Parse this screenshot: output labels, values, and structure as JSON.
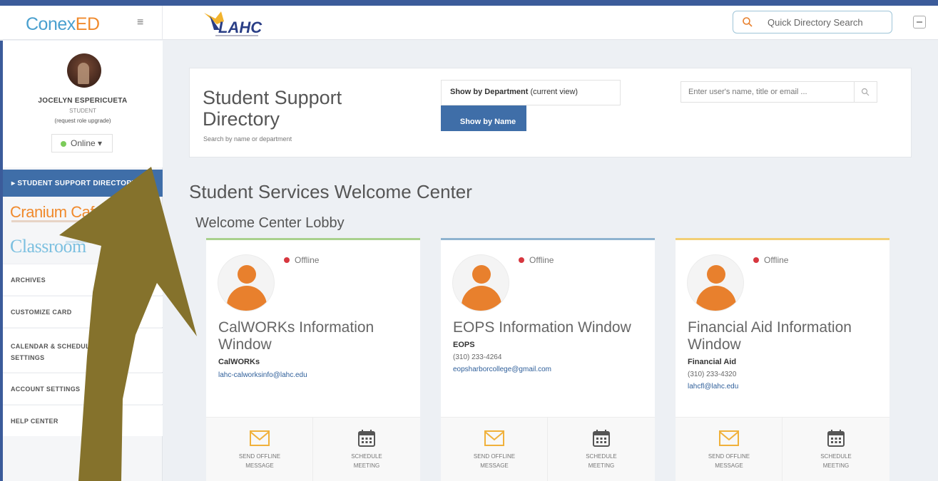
{
  "colors": {
    "accent": "#3f6ea8",
    "brand_blue": "#4aa0cf",
    "brand_orange": "#f08a2c",
    "arrow": "#85722c",
    "offline": "#d7373f",
    "online": "#7ccb5a"
  },
  "header": {
    "brand_part1": "Conex",
    "brand_part2": "ED",
    "menu_icon": "hamburger-icon",
    "logo_text": "LAHC",
    "quick_search_placeholder": "Quick Directory Search"
  },
  "profile": {
    "name": "JOCELYN ESPERICUETA",
    "role": "STUDENT",
    "upgrade": "(request role upgrade)",
    "status": "Online ▾"
  },
  "sidebar": {
    "active_item": "▸ STUDENT SUPPORT DIRECTORY",
    "cranium": "Cranium Cafe",
    "classroom": "Classroom",
    "items": [
      {
        "label": "ARCHIVES"
      },
      {
        "label": "CUSTOMIZE CARD"
      },
      {
        "label_line1": "CALENDAR & SCHEDULE",
        "label_line2": "SETTINGS"
      },
      {
        "label": "ACCOUNT SETTINGS"
      },
      {
        "label": "HELP CENTER"
      }
    ]
  },
  "directory": {
    "title": "Student Support Directory",
    "subtitle": "Search by name or department",
    "dept_button_bold": "Show by Department",
    "dept_button_rest": " (current view)",
    "name_button": "Show by Name",
    "search_placeholder": "Enter user's name, title or email ..."
  },
  "main": {
    "section_title": "Student Services Welcome Center",
    "lobby_title": "Welcome Center Lobby"
  },
  "cards": [
    {
      "status": "Offline",
      "name": "CalWORKs Information Window",
      "dept": "CalWORKs",
      "phone": "",
      "email": "lahc-calworksinfo@lahc.edu",
      "action1_line1": "SEND OFFLINE",
      "action1_line2": "MESSAGE",
      "action2_line1": "SCHEDULE",
      "action2_line2": "MEETING"
    },
    {
      "status": "Offline",
      "name": "EOPS Information Window",
      "dept": "EOPS",
      "phone": "(310) 233-4264",
      "email": "eopsharborcollege@gmail.com",
      "action1_line1": "SEND OFFLINE",
      "action1_line2": "MESSAGE",
      "action2_line1": "SCHEDULE",
      "action2_line2": "MEETING"
    },
    {
      "status": "Offline",
      "name": "Financial Aid Information Window",
      "dept": "Financial Aid",
      "phone": "(310) 233-4320",
      "email": "lahcfl@lahc.edu",
      "action1_line1": "SEND OFFLINE",
      "action1_line2": "MESSAGE",
      "action2_line1": "SCHEDULE",
      "action2_line2": "MEETING"
    }
  ]
}
